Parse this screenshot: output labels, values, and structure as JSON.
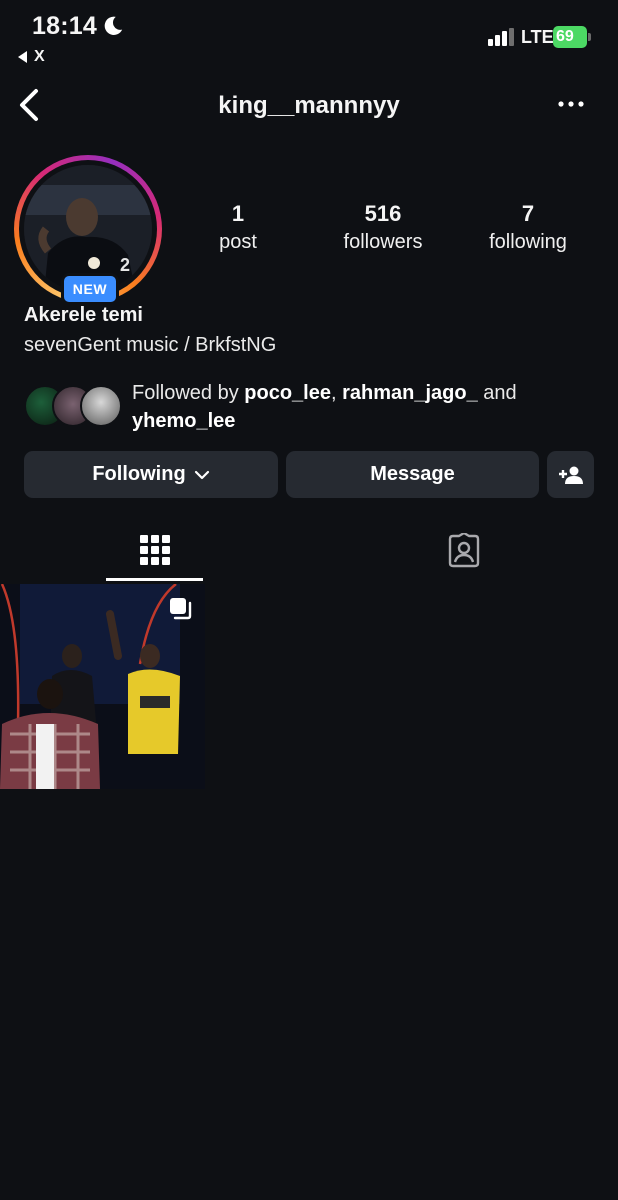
{
  "status_bar": {
    "time": "18:14",
    "back_app": "X",
    "network": "LTE",
    "battery": "69"
  },
  "header": {
    "username": "king__mannnyy"
  },
  "profile": {
    "badge": "NEW",
    "display_name": "Akerele temi",
    "bio": "sevenGent music / BrkfstNG",
    "stats": [
      {
        "value": "1",
        "label": "post"
      },
      {
        "value": "516",
        "label": "followers"
      },
      {
        "value": "7",
        "label": "following"
      }
    ],
    "followed_by": {
      "prefix": "Followed by ",
      "users": [
        "poco_lee",
        "rahman_jago_",
        "yhemo_lee"
      ],
      "sep1": ", ",
      "sep2": " and "
    }
  },
  "actions": {
    "following": "Following",
    "message": "Message"
  },
  "tabs": [
    {
      "icon": "grid-icon",
      "active": true
    },
    {
      "icon": "tagged-icon",
      "active": false
    }
  ],
  "colors": {
    "background": "#0e1014",
    "button": "#262a31",
    "badge": "#3a8dff",
    "battery": "#4cd964"
  }
}
